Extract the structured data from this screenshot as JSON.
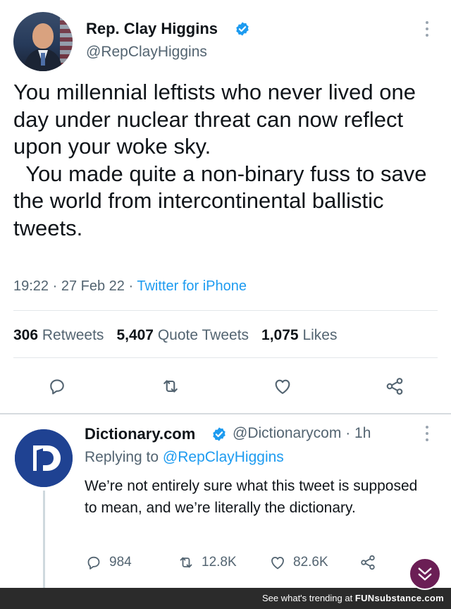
{
  "main_tweet": {
    "author_name": "Rep. Clay Higgins",
    "handle": "@RepClayHiggins",
    "text": "You millennial leftists who never lived one day under nuclear threat can now reflect upon your woke sky.\n  You made quite a non-binary fuss to save the world from intercontinental ballistic tweets.",
    "time": "19:22",
    "date": "27 Feb 22",
    "meta_sep": "·",
    "source": "Twitter for iPhone",
    "stats": {
      "retweets_count": "306",
      "retweets_label": "Retweets",
      "quotes_count": "5,407",
      "quotes_label": "Quote Tweets",
      "likes_count": "1,075",
      "likes_label": "Likes"
    }
  },
  "reply_tweet": {
    "author_name": "Dictionary.com",
    "handle": "@Dictionarycom",
    "age": "1h",
    "handle_sep": "·",
    "replying_prefix": "Replying to",
    "replying_mention": "@RepClayHiggins",
    "text": "We’re not entirely sure what this tweet is supposed to mean, and we’re literally the dictionary.",
    "replies": "984",
    "retweets": "12.8K",
    "likes": "82.6K"
  },
  "footer": {
    "prefix": "See what's trending at ",
    "brand": "FUNsubstance.com"
  },
  "icons": {
    "verified": "verified-badge-icon",
    "reply": "reply-icon",
    "retweet": "retweet-icon",
    "like": "heart-icon",
    "share": "share-icon",
    "more": "more-vertical-icon",
    "trending": "chevron-down-icon"
  },
  "colors": {
    "accent": "#1d9bf0",
    "text": "#0f1419",
    "muted": "#536471",
    "dictionary_brand": "#1f4292",
    "funsubstance_button": "#6b1e55"
  }
}
